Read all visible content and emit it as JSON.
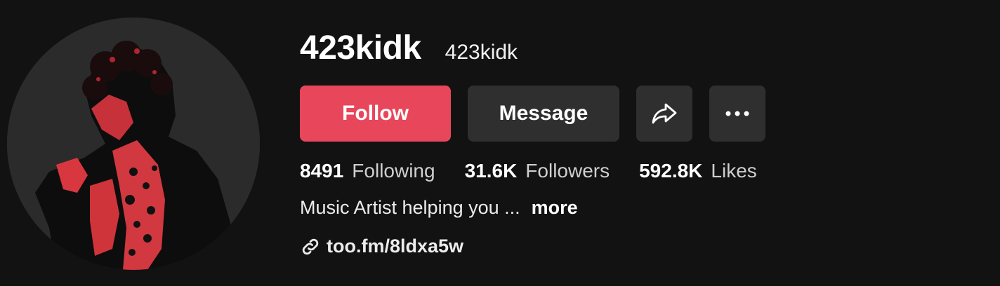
{
  "profile": {
    "username": "423kidk",
    "nickname": "423kidk",
    "avatar": "profile-photo"
  },
  "actions": {
    "follow_label": "Follow",
    "message_label": "Message",
    "share_icon": "share-arrow-icon",
    "more_icon": "more-options-icon"
  },
  "stats": {
    "following_count": "8491",
    "following_label": "Following",
    "followers_count": "31.6K",
    "followers_label": "Followers",
    "likes_count": "592.8K",
    "likes_label": "Likes"
  },
  "bio": {
    "text": "Music Artist helping you ...",
    "more_label": "more"
  },
  "link": {
    "icon": "link-icon",
    "text": "too.fm/8ldxa5w"
  },
  "colors": {
    "background": "#121212",
    "follow": "#e8465a",
    "secondary_button": "#2f2f2f",
    "avatar_accent": "#e0373f"
  }
}
